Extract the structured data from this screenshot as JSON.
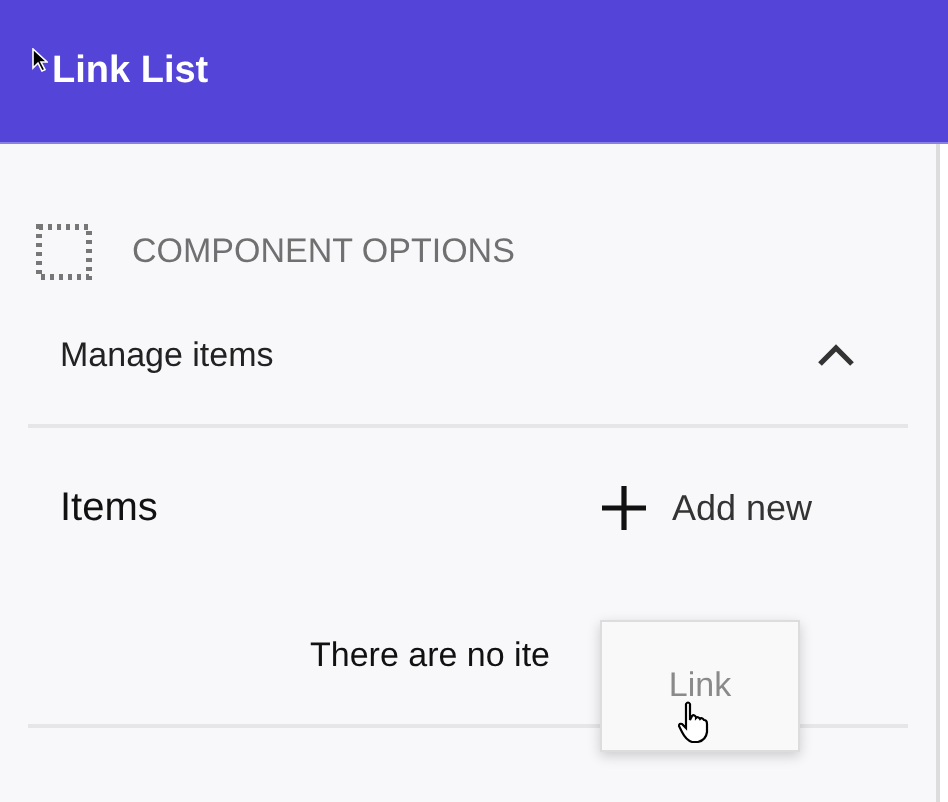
{
  "header": {
    "title": "Link List"
  },
  "section": {
    "title": "COMPONENT OPTIONS"
  },
  "group": {
    "title": "Manage items",
    "expanded": true
  },
  "items": {
    "title": "Items",
    "add_label": "Add new",
    "empty_text": "There are no ite"
  },
  "menu": {
    "items": [
      {
        "label": "Link",
        "disabled": true
      }
    ]
  }
}
